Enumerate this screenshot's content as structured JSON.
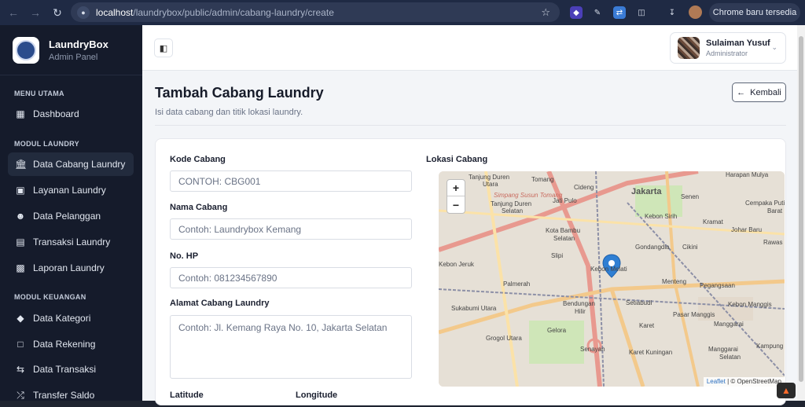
{
  "browser": {
    "url_host": "localhost",
    "url_path": "/laundrybox/public/admin/cabang-laundry/create",
    "update_label": "Chrome baru tersedia"
  },
  "sidebar": {
    "brand_title": "LaundryBox",
    "brand_sub": "Admin Panel",
    "sections": {
      "utama": "MENU UTAMA",
      "laundry": "MODUL LAUNDRY",
      "keuangan": "MODUL KEUANGAN"
    },
    "items": [
      {
        "label": "Dashboard",
        "icon": "dashboard-icon"
      },
      {
        "label": "Data Cabang Laundry",
        "icon": "building-icon"
      },
      {
        "label": "Layanan Laundry",
        "icon": "basket-icon"
      },
      {
        "label": "Data Pelanggan",
        "icon": "users-icon"
      },
      {
        "label": "Transaksi Laundry",
        "icon": "receipt-icon"
      },
      {
        "label": "Laporan Laundry",
        "icon": "report-icon"
      },
      {
        "label": "Data Kategori",
        "icon": "tag-icon"
      },
      {
        "label": "Data Rekening",
        "icon": "wallet-icon"
      },
      {
        "label": "Data Transaksi",
        "icon": "exchange-icon"
      },
      {
        "label": "Transfer Saldo",
        "icon": "shuffle-icon"
      }
    ]
  },
  "user": {
    "name": "Sulaiman Yusuf",
    "role": "Administrator"
  },
  "page": {
    "title": "Tambah Cabang Laundry",
    "subtitle": "Isi data cabang dan titik lokasi laundry.",
    "back_label": "Kembali"
  },
  "form": {
    "kode_label": "Kode Cabang",
    "kode_placeholder": "CONTOH: CBG001",
    "nama_label": "Nama Cabang",
    "nama_placeholder": "Contoh: Laundrybox Kemang",
    "hp_label": "No. HP",
    "hp_placeholder": "Contoh: 081234567890",
    "alamat_label": "Alamat Cabang Laundry",
    "alamat_placeholder": "Contoh: Jl. Kemang Raya No. 10, Jakarta Selatan",
    "lat_label": "Latitude",
    "lng_label": "Longitude",
    "lokasi_label": "Lokasi Cabang"
  },
  "map": {
    "zoom_in": "+",
    "zoom_out": "−",
    "attribution_leaflet": "Leaflet",
    "attribution_osm": "| © OpenStreetMap",
    "labels": {
      "tanjung_duren": "Tanjung Duren",
      "utara": "Utara",
      "tomang": "Tomang",
      "cideng": "Cideng",
      "jakarta": "Jakarta",
      "senen": "Senen",
      "harapan_mulya": "Harapan Mulya",
      "simpang_susun": "Simpang Susun Tomang",
      "tanjung_duren_selatan": "Tanjung Duren",
      "selatan": "Selatan",
      "jati_pulo": "Jati Pulo",
      "kebon_sirih": "Kebon Sirih",
      "cempaka_putih": "Cempaka Putih",
      "barat": "Barat",
      "kramat": "Kramat",
      "johar_baru": "Johar Baru",
      "kota_bambu": "Kota Bambu",
      "kota_bambu_sel": "Selatan",
      "slipi": "Slipi",
      "gondangdia": "Gondangdia",
      "cikini": "Cikini",
      "rawas": "Rawas",
      "kebon_jeruk": "Kebon Jeruk",
      "kebon_melati": "Kebon Melati",
      "menteng": "Menteng",
      "pegangsaan": "Pegangsaan",
      "palmerah": "Palmerah",
      "bendungan_hilir": "Bendungan",
      "hilir": "Hilir",
      "setiabudi": "Setiabudi",
      "kebon_manggis": "Kebon Manggis",
      "sukabumi_utara": "Sukabumi Utara",
      "pasar_manggis": "Pasar Manggis",
      "manggarai": "Manggarai",
      "karet": "Karet",
      "grogol_utara": "Grogol Utara",
      "gelora": "Gelora",
      "karet_kuningan": "Karet Kuningan",
      "manggarai_selatan": "Manggarai",
      "manggarai_selatan2": "Selatan",
      "kampung_m": "Kampung M",
      "senayan": "Senayan"
    }
  }
}
